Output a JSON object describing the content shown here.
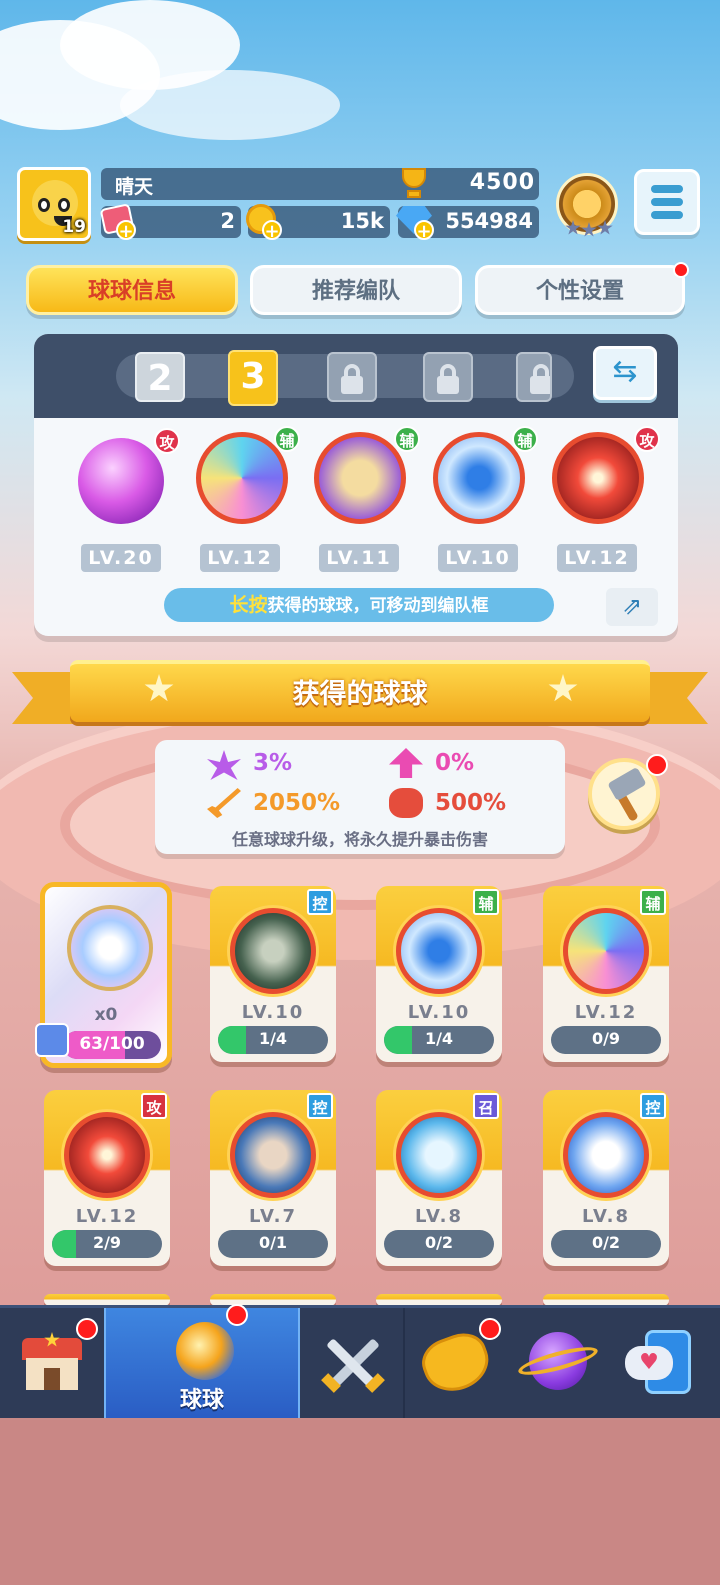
{
  "player": {
    "name": "晴天",
    "level": "19",
    "trophies": "4500",
    "tickets": "2",
    "coins": "15k",
    "gems": "554984"
  },
  "tabs": [
    {
      "label": "球球信息",
      "active": true
    },
    {
      "label": "推荐编队",
      "active": false
    },
    {
      "label": "个性设置",
      "active": false,
      "has_notification": true
    }
  ],
  "team": {
    "slots": [
      {
        "label": "2",
        "state": "unlocked"
      },
      {
        "label": "3",
        "state": "selected"
      },
      {
        "label": "",
        "state": "locked"
      },
      {
        "label": "",
        "state": "locked"
      },
      {
        "label": "",
        "state": "locked"
      }
    ],
    "balls": [
      {
        "level": "LV.20",
        "tag": "攻",
        "icon": "crystal-ball-icon"
      },
      {
        "level": "LV.12",
        "tag": "辅",
        "icon": "swirl-ball-icon"
      },
      {
        "level": "LV.11",
        "tag": "辅",
        "icon": "clone-ball-icon"
      },
      {
        "level": "LV.10",
        "tag": "辅",
        "icon": "bow-ball-icon"
      },
      {
        "level": "LV.12",
        "tag": "攻",
        "icon": "fire-ball-icon"
      }
    ],
    "hint_highlight": "长按",
    "hint_text": "获得的球球，可移动到编队框"
  },
  "section_title": "获得的球球",
  "stats": {
    "crit_chance": "3%",
    "second_stat": "0%",
    "crit_damage": "2050%",
    "fourth_stat": "500%",
    "description": "任意球球升级，将永久提升暴击伤害"
  },
  "special_card": {
    "count": "x0",
    "progress": "63/100",
    "fraction": 0.63
  },
  "cards": [
    {
      "level": "LV.10",
      "tag": "控",
      "progress": "1/4",
      "fraction": 0.25,
      "icon": "ninja-ball-icon"
    },
    {
      "level": "LV.10",
      "tag": "辅",
      "progress": "1/4",
      "fraction": 0.25,
      "icon": "bow-ball-icon"
    },
    {
      "level": "LV.12",
      "tag": "辅",
      "progress": "0/9",
      "fraction": 0,
      "icon": "swirl-ball-icon"
    },
    {
      "level": "LV.12",
      "tag": "攻",
      "progress": "2/9",
      "fraction": 0.22,
      "icon": "fire-ball-icon"
    },
    {
      "level": "LV.7",
      "tag": "控",
      "progress": "0/1",
      "fraction": 0,
      "icon": "warrior-ball-icon"
    },
    {
      "level": "LV.8",
      "tag": "召",
      "progress": "0/2",
      "fraction": 0,
      "icon": "feather-ball-icon"
    },
    {
      "level": "LV.8",
      "tag": "控",
      "progress": "0/2",
      "fraction": 0,
      "icon": "magician-ball-icon"
    }
  ],
  "nav": [
    {
      "name": "shop",
      "label": "",
      "notification": true
    },
    {
      "name": "balls",
      "label": "球球",
      "active": true,
      "notification": true
    },
    {
      "name": "battle",
      "label": "",
      "notification": false
    },
    {
      "name": "whistle",
      "label": "",
      "notification": true
    },
    {
      "name": "planet",
      "label": "",
      "notification": false
    },
    {
      "name": "chat",
      "label": "",
      "notification": false
    }
  ],
  "colors": {
    "accent_yellow": "#f7c21b",
    "tab_text_active": "#d93f27",
    "nav_bg": "#2e3b57"
  }
}
